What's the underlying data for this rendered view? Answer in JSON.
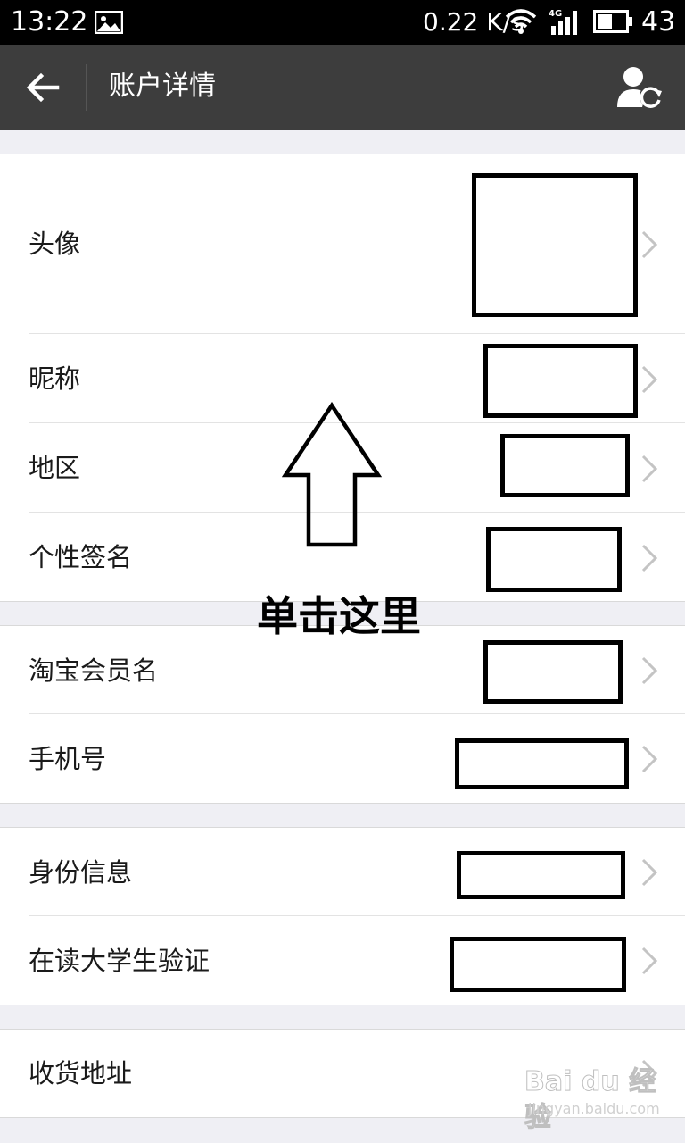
{
  "status_bar": {
    "time": "13:22",
    "speed": "0.22 K/s",
    "network": "4G",
    "battery": "43"
  },
  "header": {
    "title": "账户详情"
  },
  "rows": [
    {
      "label": "头像"
    },
    {
      "label": "昵称"
    },
    {
      "label": "地区"
    },
    {
      "label": "个性签名"
    },
    {
      "label": "淘宝会员名"
    },
    {
      "label": "手机号"
    },
    {
      "label": "身份信息"
    },
    {
      "label": "在读大学生验证"
    },
    {
      "label": "收货地址"
    }
  ],
  "annotation": {
    "callout": "单击这里"
  },
  "watermark": {
    "brand": "Bai du 经验",
    "url": "jingyan.baidu.com"
  },
  "icons": {
    "back": "arrow-left-icon",
    "switch_account": "user-refresh-icon",
    "chevron": "chevron-right-icon"
  }
}
